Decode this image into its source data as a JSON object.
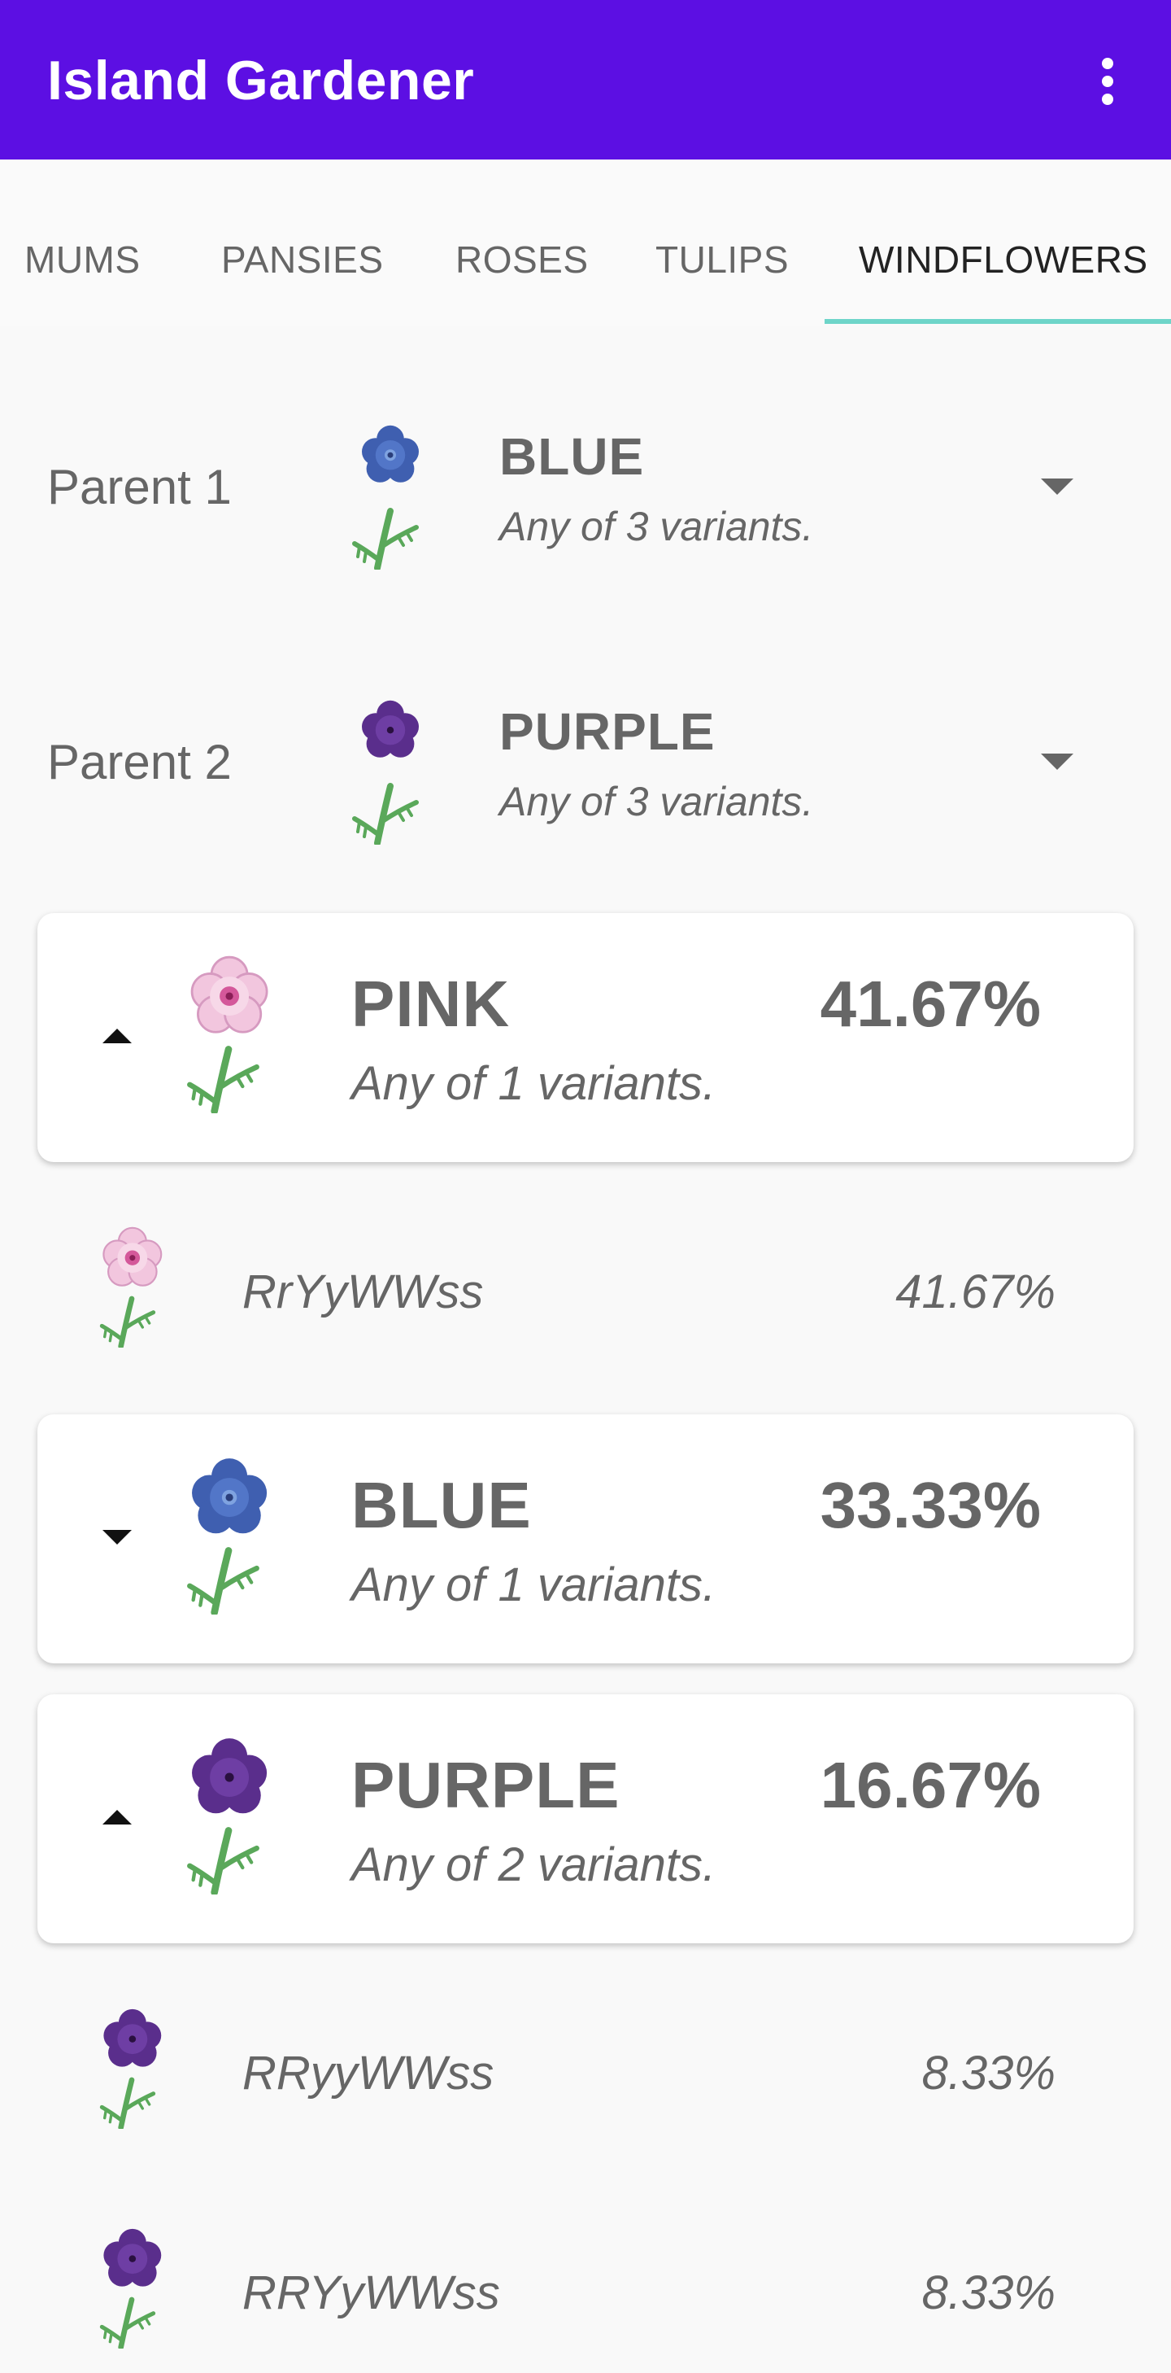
{
  "app": {
    "title": "Island Gardener",
    "overflow_icon": "more-vert-icon"
  },
  "tabs": [
    {
      "label": "MUMS",
      "active": false
    },
    {
      "label": "PANSIES",
      "active": false
    },
    {
      "label": "ROSES",
      "active": false
    },
    {
      "label": "TULIPS",
      "active": false
    },
    {
      "label": "WINDFLOWERS",
      "active": true
    }
  ],
  "parents": [
    {
      "label": "Parent 1",
      "color": "BLUE",
      "subtitle": "Any of 3 variants.",
      "icon": "blue-windflower-icon"
    },
    {
      "label": "Parent 2",
      "color": "PURPLE",
      "subtitle": "Any of 3 variants.",
      "icon": "purple-windflower-icon"
    }
  ],
  "results": [
    {
      "color": "PINK",
      "subtitle": "Any of 1 variants.",
      "percent": "41.67%",
      "expanded": true,
      "icon": "pink-windflower-icon",
      "variants": [
        {
          "genotype": "RrYyWWss",
          "percent": "41.67%"
        }
      ]
    },
    {
      "color": "BLUE",
      "subtitle": "Any of 1 variants.",
      "percent": "33.33%",
      "expanded": false,
      "icon": "blue-windflower-icon",
      "variants": []
    },
    {
      "color": "PURPLE",
      "subtitle": "Any of 2 variants.",
      "percent": "16.67%",
      "expanded": true,
      "icon": "purple-windflower-icon",
      "variants": [
        {
          "genotype": "RRyyWWss",
          "percent": "8.33%"
        },
        {
          "genotype": "RRYyWWss",
          "percent": "8.33%"
        }
      ]
    }
  ],
  "colors": {
    "appbar": "#5c0fe3",
    "tab_indicator": "#6ed5c9",
    "flower_blue": "#3f5fb0",
    "flower_purple": "#5a2e8c",
    "flower_pink": "#f2c6de",
    "stem": "#5aa85a"
  }
}
